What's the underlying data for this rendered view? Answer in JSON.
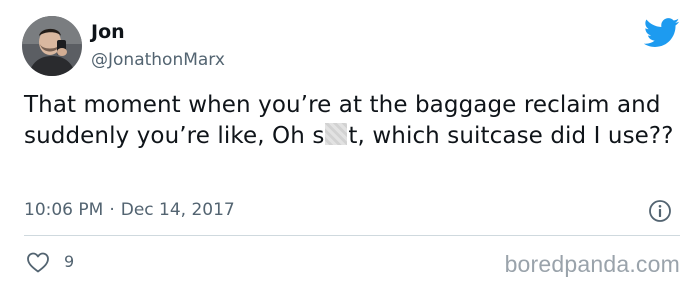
{
  "tweet": {
    "author": {
      "display_name": "Jon",
      "handle": "@JonathonMarx",
      "avatar_icon": "profile-photo"
    },
    "text_before_censor": "That moment when you’re at the baggage reclaim and suddenly you’re like, Oh s",
    "text_after_censor": "t, which suitcase did I use??",
    "time": "10:06 PM",
    "separator": "·",
    "date": "Dec 14, 2017",
    "like_count": "9",
    "brand_icon": "twitter-bird-icon",
    "brand_color": "#1d9bf0"
  },
  "watermark": {
    "text": "boredpanda.com"
  }
}
